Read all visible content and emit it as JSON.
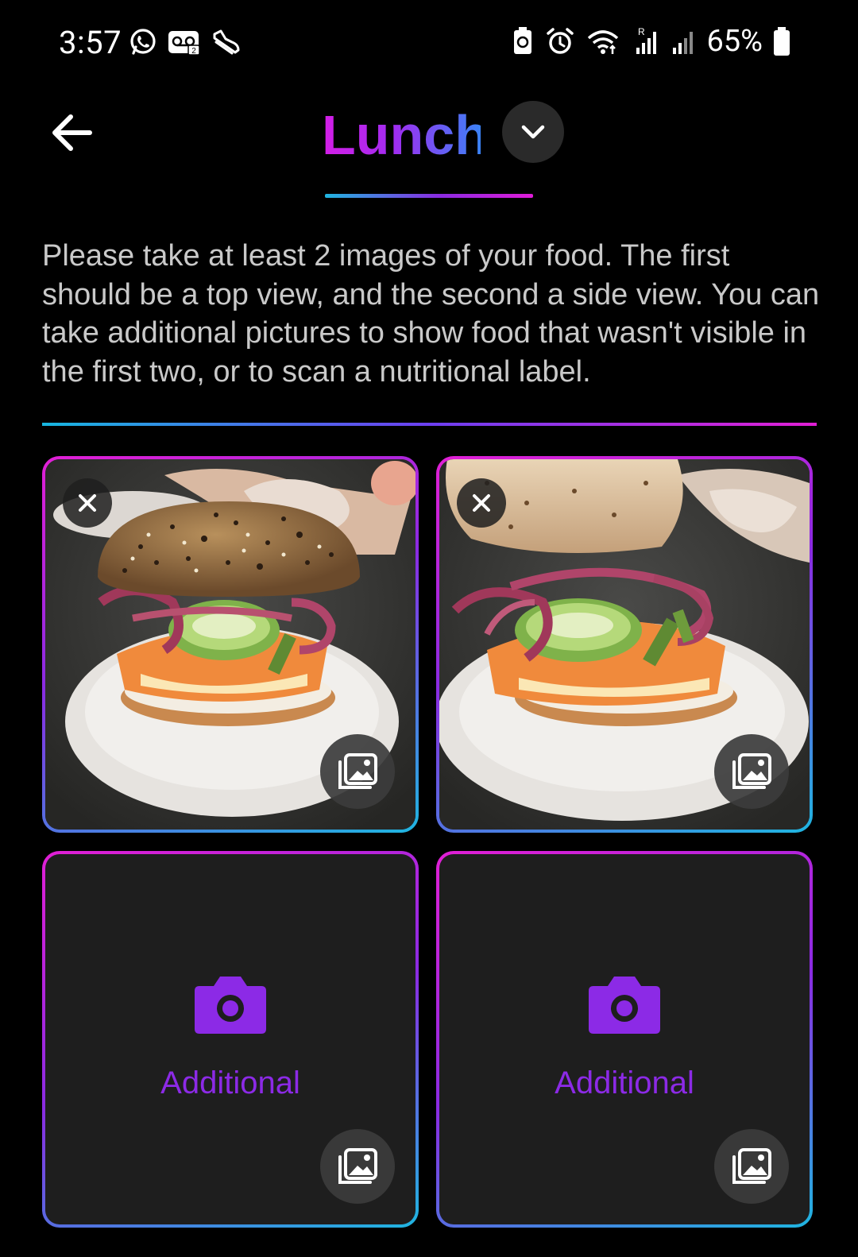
{
  "status_bar": {
    "time": "3:57",
    "battery": "65%",
    "left_icons": [
      "whatsapp-icon",
      "voicemail-icon",
      "shoe-icon"
    ],
    "right_icons": [
      "battery-saver-icon",
      "alarm-icon",
      "wifi-icon",
      "signal-icon",
      "signal-icon",
      "battery-icon"
    ]
  },
  "header": {
    "title": "Lunch",
    "back_icon": "arrow-left-icon",
    "dropdown_icon": "chevron-down-icon"
  },
  "instructions": "Please take at least 2 images of your food. The first should be a top view, and the second a side view. You can take additional pictures to show food that wasn't visible in the first two, or to scan a nutritional label.",
  "photos": [
    {
      "state": "captured",
      "subject": "bagel sandwich on plate",
      "remove_icon": "close-icon",
      "gallery_icon": "gallery-icon"
    },
    {
      "state": "captured",
      "subject": "open bagel sandwich on plate",
      "remove_icon": "close-icon",
      "gallery_icon": "gallery-icon"
    },
    {
      "state": "empty",
      "label": "Additional",
      "icon": "camera-icon",
      "gallery_icon": "gallery-icon"
    },
    {
      "state": "empty",
      "label": "Additional",
      "icon": "camera-icon",
      "gallery_icon": "gallery-icon"
    }
  ],
  "colors": {
    "accent_magenta": "#e11fd5",
    "accent_purple": "#8c2ae6",
    "accent_cyan": "#1fb5e0",
    "background": "#000000",
    "card_bg": "#1e1e1e",
    "text_secondary": "#c9c9c9"
  }
}
